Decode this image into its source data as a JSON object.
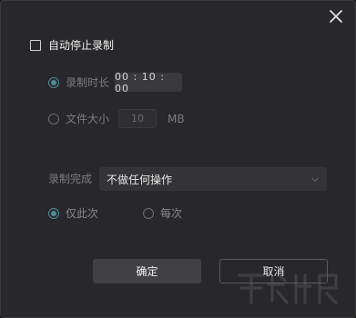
{
  "auto_stop": {
    "label": "自动停止录制",
    "checked": false
  },
  "duration": {
    "label": "录制时长",
    "value": "00 : 10 : 00",
    "selected": true
  },
  "filesize": {
    "label": "文件大小",
    "value": "10",
    "unit": "MB",
    "selected": false
  },
  "on_complete": {
    "label": "录制完成",
    "selected_value": "不做任何操作"
  },
  "frequency": {
    "once_label": "仅此次",
    "every_label": "每次",
    "selected": "once"
  },
  "buttons": {
    "ok_label": "确定",
    "cancel_label": "取消"
  },
  "icons": {
    "close": "close-icon",
    "dropdown": "chevron-down-icon"
  },
  "colors": {
    "accent": "#4f8a98",
    "background": "#28272a"
  }
}
